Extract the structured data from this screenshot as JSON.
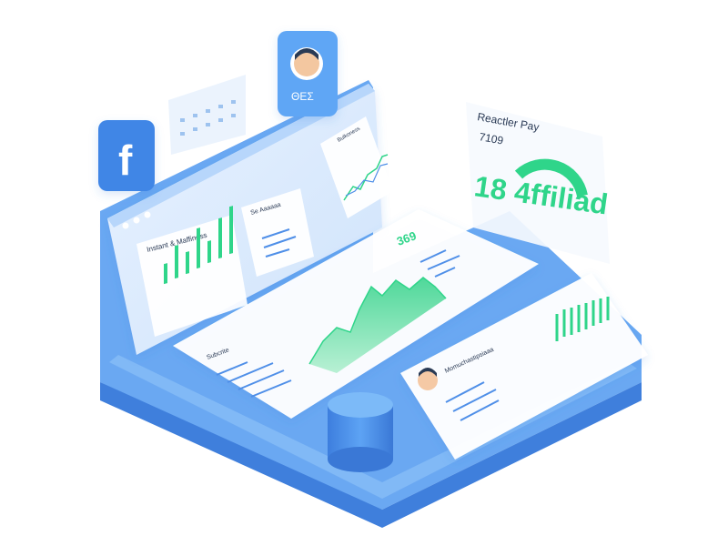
{
  "colors": {
    "base_blue": "#5b9ff0",
    "base_blue_dark": "#3f7fdc",
    "panel_bg": "#f3f8ff",
    "accent_green": "#2fd58a",
    "accent_blue": "#4f8fe8",
    "text_dark": "#2a3a55"
  },
  "icons": [
    "facebook-icon",
    "avatar",
    "calendar-grid-icon",
    "window-dots-icon",
    "gauge-icon",
    "user-avatar-icon",
    "cylinder-knob"
  ],
  "texts": {
    "avatar_bubble_label": "ΘΕΣ",
    "floating_card_title": "Reactler Pay",
    "floating_card_sub": "7109",
    "floating_card_big": "18 4ffiliad",
    "left_panel_title": "Instant & Maffiness",
    "mid_card_title": "Se Aaaaaa",
    "top_chart_title": "Bulkoness",
    "center_number": "369",
    "bottom_left_title": "Subcrite",
    "bottom_right_title": "Momuchastipsiaaa"
  }
}
